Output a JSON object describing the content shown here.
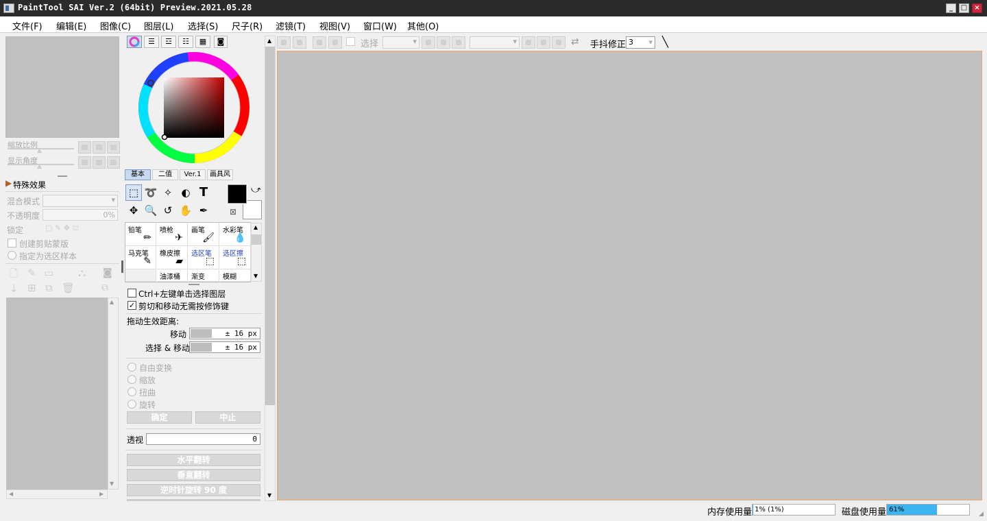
{
  "window": {
    "title": "PaintTool SAI Ver.2 (64bit) Preview.2021.05.28",
    "controls": [
      "_",
      "□",
      "×"
    ]
  },
  "menu": [
    "文件(F)",
    "编辑(E)",
    "图像(C)",
    "图层(L)",
    "选择(S)",
    "尺子(R)",
    "滤镜(T)",
    "视图(V)",
    "窗口(W)",
    "其他(O)"
  ],
  "topbar": {
    "select_label": "选择",
    "stabilizer_label": "手抖修正",
    "stabilizer_value": "3"
  },
  "navigator": {
    "zoom_label": "缩放比例",
    "angle_label": "显示角度"
  },
  "layer_panel": {
    "effects_label": "特殊效果",
    "blend_label": "混合模式",
    "opacity_label": "不透明度",
    "opacity_value": "0%",
    "lock_label": "锁定",
    "clip_label": "创建剪贴蒙版",
    "sel_source_label": "指定为选区样本"
  },
  "color_panel": {
    "tabs": [
      "基本",
      "二值",
      "Ver.1",
      "画具风"
    ],
    "fg_color": "#000000",
    "bg_color": "#ffffff"
  },
  "brushes": [
    {
      "name": "铅笔",
      "icon": "pencil-icon"
    },
    {
      "name": "喷枪",
      "icon": "airbrush-icon"
    },
    {
      "name": "画笔",
      "icon": "brush-icon"
    },
    {
      "name": "水彩笔",
      "icon": "watercolor-icon"
    },
    {
      "name": "马克笔",
      "icon": "marker-icon"
    },
    {
      "name": "橡皮擦",
      "icon": "eraser-icon"
    },
    {
      "name": "选区笔",
      "icon": "selpen-icon"
    },
    {
      "name": "选区擦",
      "icon": "selerase-icon"
    },
    {
      "name": "",
      "icon": ""
    },
    {
      "name": "油漆桶",
      "icon": "bucket-icon"
    },
    {
      "name": "渐变",
      "icon": "gradient-icon"
    },
    {
      "name": "模糊",
      "icon": "blur-icon"
    }
  ],
  "tool_options": {
    "ctrl_click_label": "Ctrl+左键单击选择图层",
    "cut_move_label": "剪切和移动无需按修饰键",
    "drag_label": "拖动生效距离:",
    "move_label": "移动",
    "move_value": "± 16 px",
    "select_move_label": "选择 & 移动",
    "select_move_value": "± 16 px",
    "transforms": [
      "自由变换",
      "缩放",
      "扭曲",
      "旋转"
    ],
    "ok_label": "确定",
    "cancel_label": "中止",
    "perspective_label": "透视",
    "perspective_value": "0",
    "flip_h_label": "水平翻转",
    "flip_v_label": "垂直翻转",
    "rotate_label": "逆时针旋转 90 度"
  },
  "status": {
    "mem_label": "内存使用量",
    "mem_value": "1% (1%)",
    "mem_fraction": 0.01,
    "disk_label": "磁盘使用量",
    "disk_value": "61%",
    "disk_fraction": 0.61
  }
}
